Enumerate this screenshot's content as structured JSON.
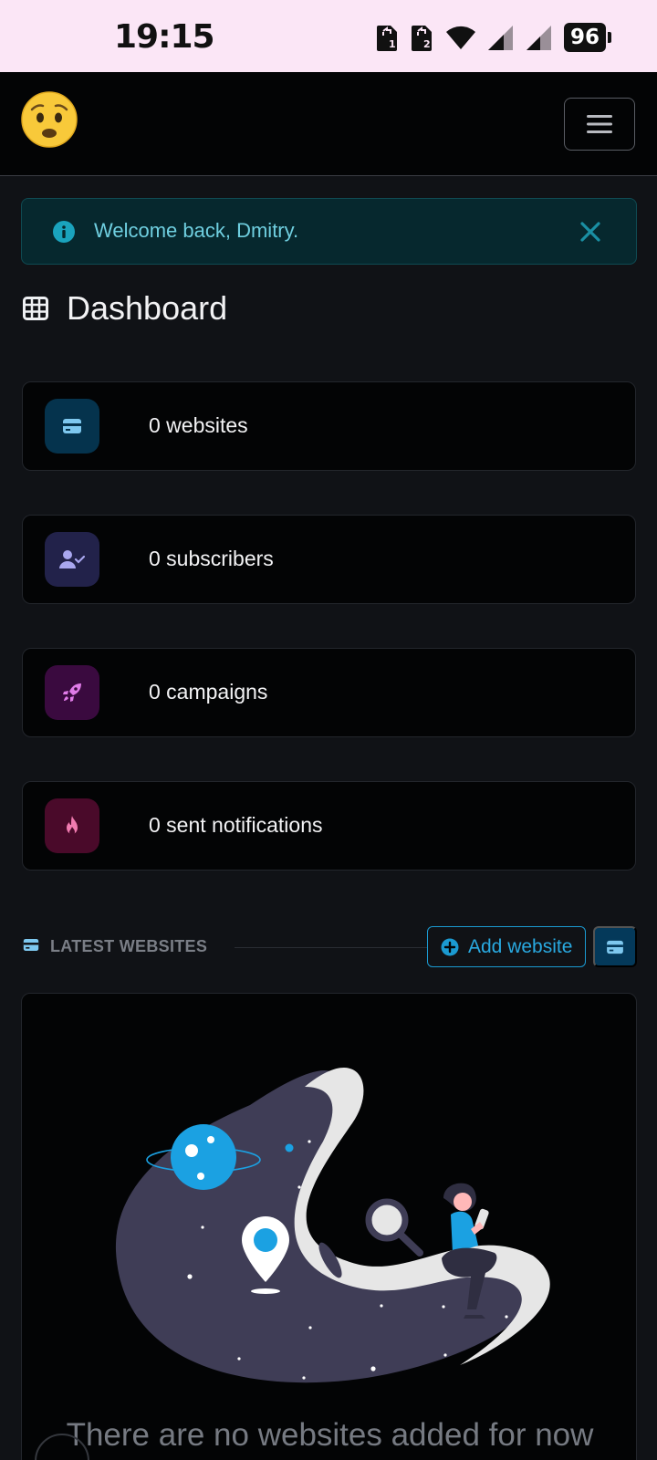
{
  "status_bar": {
    "time": "19:15",
    "battery": "96"
  },
  "nav": {
    "avatar_icon": "worried-face-emoji",
    "menu_icon": "hamburger-menu-icon"
  },
  "alert": {
    "message": "Welcome back, Dmitry.",
    "color": "#6fcfe0"
  },
  "page": {
    "title": "Dashboard"
  },
  "stats": [
    {
      "label": "0 websites",
      "icon": "website-card-icon",
      "color": "#7ec8ef",
      "bg": "#05334d"
    },
    {
      "label": "0 subscribers",
      "icon": "user-check-icon",
      "color": "#a9a7ef",
      "bg": "#22224a"
    },
    {
      "label": "0 campaigns",
      "icon": "rocket-icon",
      "color": "#e07be8",
      "bg": "#3a0a3f"
    },
    {
      "label": "0 sent notifications",
      "icon": "fire-icon",
      "color": "#f07bb0",
      "bg": "#4a0a2a"
    }
  ],
  "latest": {
    "title": "LATEST WEBSITES",
    "add_label": "Add website",
    "empty_text": "There are no websites added for now"
  },
  "colors": {
    "accent": "#29a9e0",
    "background": "#101216",
    "card": "#030405"
  }
}
